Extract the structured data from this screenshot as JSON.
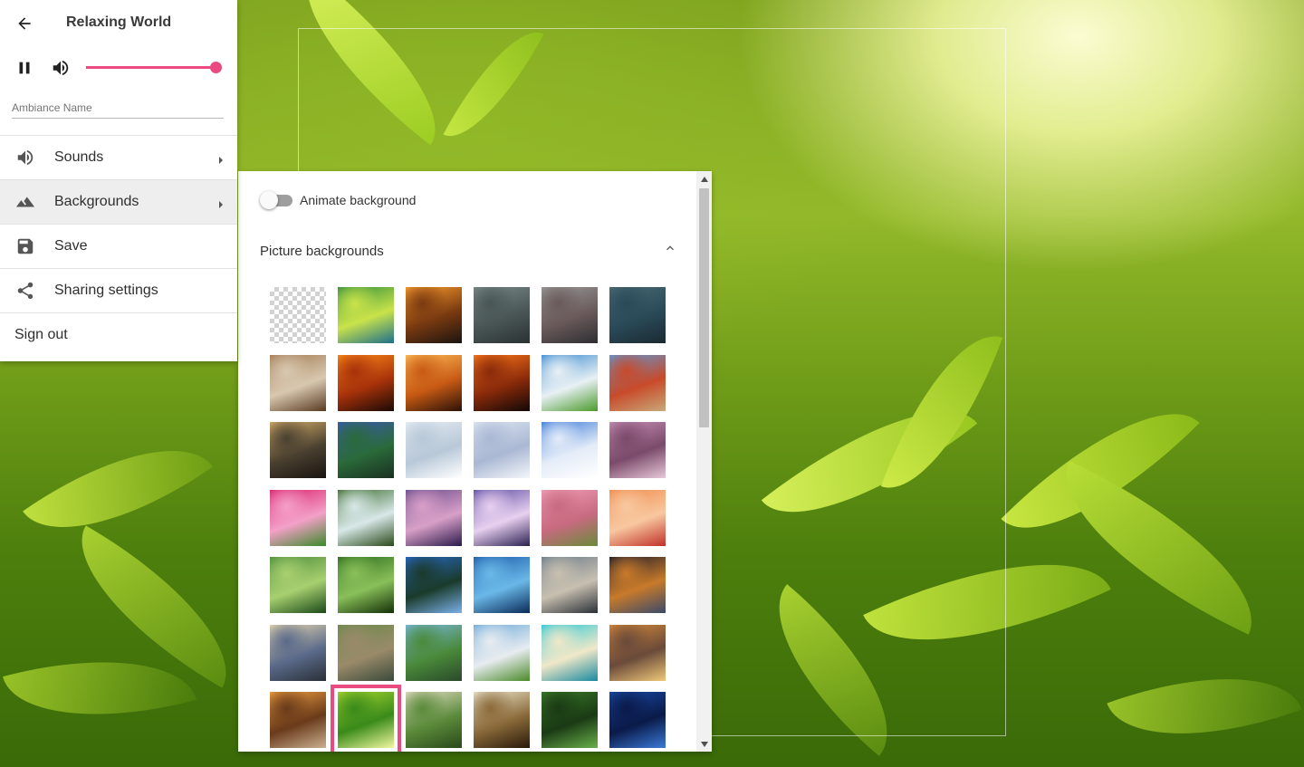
{
  "header": {
    "title": "Relaxing World"
  },
  "player": {
    "volume_percent": 100
  },
  "ambiance": {
    "placeholder": "Ambiance Name",
    "value": ""
  },
  "menu": {
    "items": [
      {
        "label": "Sounds",
        "icon": "volume-icon",
        "has_submenu": true,
        "active": false
      },
      {
        "label": "Backgrounds",
        "icon": "landscape-icon",
        "has_submenu": true,
        "active": true
      },
      {
        "label": "Save",
        "icon": "save-icon",
        "has_submenu": false,
        "active": false
      },
      {
        "label": "Sharing settings",
        "icon": "share-icon",
        "has_submenu": false,
        "active": false
      },
      {
        "label": "Sign out",
        "icon": "",
        "has_submenu": false,
        "active": false
      }
    ]
  },
  "backgrounds_panel": {
    "animate_label": "Animate background",
    "animate_on": false,
    "section_title": "Picture backgrounds",
    "selected_index": 37,
    "thumbnails": [
      {
        "name": "transparent",
        "colors": [
          "#ffffff",
          "#d2d2d2"
        ]
      },
      {
        "name": "bokeh-green",
        "colors": [
          "#2f8e3c",
          "#c9e34a",
          "#1d6f8a"
        ]
      },
      {
        "name": "sunset-sea",
        "colors": [
          "#ff9f2e",
          "#7a3a10",
          "#1c1410"
        ]
      },
      {
        "name": "rain-window",
        "colors": [
          "#7a8a8a",
          "#4a5656",
          "#2a3232"
        ]
      },
      {
        "name": "rain-street",
        "colors": [
          "#9a9a9a",
          "#6a5a5a",
          "#2e2e32"
        ]
      },
      {
        "name": "rain-water",
        "colors": [
          "#4a6a74",
          "#2a4a58",
          "#1a2a32"
        ]
      },
      {
        "name": "cozy-room",
        "colors": [
          "#a27a52",
          "#d8c8b0",
          "#5a3a22"
        ]
      },
      {
        "name": "fireplace",
        "colors": [
          "#ff8c1a",
          "#a8320a",
          "#1a0a06"
        ]
      },
      {
        "name": "campfire",
        "colors": [
          "#ffbf5a",
          "#c85a14",
          "#2a1208"
        ]
      },
      {
        "name": "fire-logs",
        "colors": [
          "#ff7a1a",
          "#8a2a0a",
          "#120806"
        ]
      },
      {
        "name": "mountain-meadow",
        "colors": [
          "#3a8ad0",
          "#e8f0f4",
          "#4a9a2a"
        ]
      },
      {
        "name": "golden-gate",
        "colors": [
          "#5a9ad8",
          "#c84a2a",
          "#c8a878"
        ]
      },
      {
        "name": "candle-bokeh",
        "colors": [
          "#d8b06a",
          "#4a4030",
          "#181410"
        ]
      },
      {
        "name": "blue-flowers",
        "colors": [
          "#3a5ab0",
          "#2a6a3a",
          "#1a3020"
        ]
      },
      {
        "name": "snow-trees",
        "colors": [
          "#e8eef4",
          "#b8c8d8",
          "#ffffff"
        ]
      },
      {
        "name": "snowy-forest",
        "colors": [
          "#dde6f2",
          "#aab8d4",
          "#f4f6fa"
        ]
      },
      {
        "name": "snow-house",
        "colors": [
          "#3a7ad8",
          "#e4ecf8",
          "#ffffff"
        ]
      },
      {
        "name": "cherry-tree",
        "colors": [
          "#c890b8",
          "#7a4a6a",
          "#e8c8d8"
        ]
      },
      {
        "name": "tulips",
        "colors": [
          "#d8206a",
          "#f4a0c8",
          "#3a8a2a"
        ]
      },
      {
        "name": "waterfall",
        "colors": [
          "#3a6a2a",
          "#d8e8e8",
          "#2a4a1a"
        ]
      },
      {
        "name": "cherry-blossom-dark",
        "colors": [
          "#6a4a8a",
          "#d8a0c8",
          "#2a1a4a"
        ]
      },
      {
        "name": "blossom-purple",
        "colors": [
          "#5a4aa0",
          "#e8d0f0",
          "#2a2050"
        ]
      },
      {
        "name": "blossom-path",
        "colors": [
          "#f0a0b8",
          "#c86a80",
          "#6a8a3a"
        ]
      },
      {
        "name": "blossom-orange",
        "colors": [
          "#f08a4a",
          "#f8c8a0",
          "#c0302a"
        ]
      },
      {
        "name": "bamboo",
        "colors": [
          "#4a8a3a",
          "#a8d070",
          "#1a4a1a"
        ]
      },
      {
        "name": "forest-ferns",
        "colors": [
          "#2a6a1a",
          "#8ac05a",
          "#143008"
        ]
      },
      {
        "name": "lake-forest",
        "colors": [
          "#2a6ac8",
          "#1a3a2a",
          "#7ab0e8"
        ]
      },
      {
        "name": "ocean-wave",
        "colors": [
          "#1a5aa8",
          "#6ab8e8",
          "#0a2a58"
        ]
      },
      {
        "name": "city-skyline",
        "colors": [
          "#6a7a8a",
          "#c8c0b0",
          "#2a3038"
        ]
      },
      {
        "name": "night-city",
        "colors": [
          "#1a1a2a",
          "#c87a2a",
          "#3a4a6a"
        ]
      },
      {
        "name": "harbor-town",
        "colors": [
          "#e8d8b0",
          "#5a6a8a",
          "#2a3038"
        ]
      },
      {
        "name": "village-road",
        "colors": [
          "#6a8a4a",
          "#9a8a6a",
          "#3a4a3a"
        ]
      },
      {
        "name": "lone-tree",
        "colors": [
          "#7ab8e0",
          "#4a8a3a",
          "#2a4a2a"
        ]
      },
      {
        "name": "alps",
        "colors": [
          "#6aa8d8",
          "#e8ecf0",
          "#4a8a2a"
        ]
      },
      {
        "name": "tropical-beach",
        "colors": [
          "#2ac8d8",
          "#f0e8c8",
          "#1a8aa0"
        ]
      },
      {
        "name": "sunset-clouds",
        "colors": [
          "#d88a3a",
          "#6a4a3a",
          "#f0c878"
        ]
      },
      {
        "name": "beach-sunset",
        "colors": [
          "#f0a040",
          "#6a3a1a",
          "#c8b090"
        ]
      },
      {
        "name": "green-tea-leaves",
        "colors": [
          "#a8d830",
          "#3a8a1a",
          "#f0f8a0"
        ]
      },
      {
        "name": "green-valley",
        "colors": [
          "#e8e0c8",
          "#5a8a3a",
          "#2a4a1a"
        ]
      },
      {
        "name": "crocus",
        "colors": [
          "#f0e8d0",
          "#8a6a3a",
          "#2a1a0a"
        ]
      },
      {
        "name": "grass-dark",
        "colors": [
          "#3a7a2a",
          "#1a3a14",
          "#6ab04a"
        ]
      },
      {
        "name": "night-sky",
        "colors": [
          "#1a4aa8",
          "#0a1a48",
          "#3a7ad8"
        ]
      }
    ]
  }
}
